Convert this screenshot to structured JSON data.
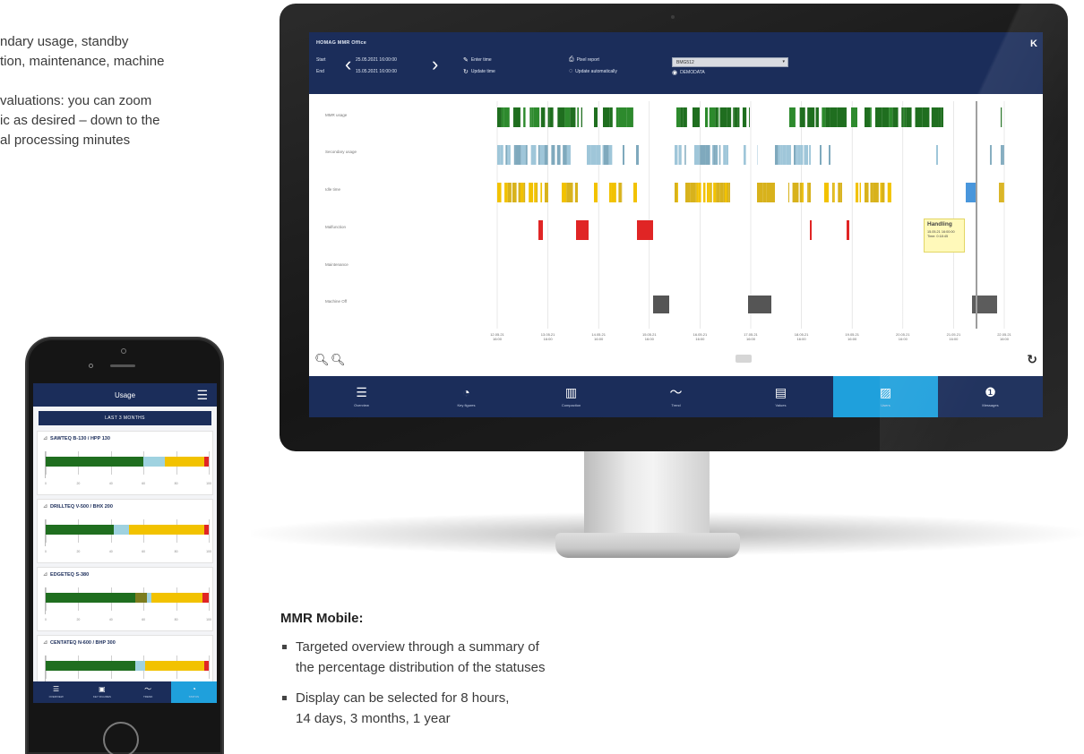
{
  "intro": {
    "para1": "ndary usage, standby\ntion, maintenance, machine",
    "para2": "valuations: you can zoom\nic as desired – down to the\nal processing minutes"
  },
  "app": {
    "title": "HOMAG MMR Office",
    "logo": "K",
    "start_label": "Start",
    "end_label": "End",
    "start_date": "25.05.2021 16:00:00",
    "end_date": "15.05.2021 16:00:00",
    "enter_time": "Enter time",
    "update_time": "Update time",
    "pixel_report": "Pixel report",
    "update_auto": "Update automatically",
    "machine": "BMG512",
    "demodata": "DEMODATA",
    "rows": [
      "MMR usage",
      "Secondary usage",
      "Idle time",
      "Malfunction",
      "Maintenance",
      "Machine Off"
    ],
    "time_ticks": [
      "12.05.21\n16:00",
      "13.05.21\n16:00",
      "14.05.21\n16:00",
      "15.05.21\n16:00",
      "16.05.21\n16:00",
      "17.05.21\n16:00",
      "18.05.21\n16:00",
      "19.05.21\n16:00",
      "20.05.21\n16:00",
      "21.05.21\n16:00",
      "22.05.21\n16:00"
    ],
    "tooltip": {
      "title": "Handling",
      "lines": "15.05.21 16:00:00\nTime: 0:18:45"
    },
    "nav": [
      {
        "label": "Overview",
        "icon": "☰"
      },
      {
        "label": "Key figures",
        "icon": "◔"
      },
      {
        "label": "Compaction",
        "icon": "▥"
      },
      {
        "label": "Trend",
        "icon": "〜"
      },
      {
        "label": "Values",
        "icon": "▤"
      },
      {
        "label": "Users",
        "icon": "▨",
        "active": true
      },
      {
        "label": "Messages",
        "icon": "❶"
      }
    ],
    "colors": {
      "dark_green": "#1f6e1f",
      "light_blue": "#9fc6d9",
      "yellow": "#f2c200",
      "red": "#e02525",
      "gray": "#555555",
      "navy": "#1b2d5a",
      "accent": "#1fa0dc"
    }
  },
  "phone": {
    "title": "Usage",
    "period": "LAST 3 MONTHS",
    "ticks": [
      "0",
      "20",
      "40",
      "60",
      "80",
      "100"
    ],
    "machines": [
      {
        "name": "SAWTEQ B-130 / HPP 130",
        "segments": [
          {
            "color": "#1f6e1f",
            "pct": 60
          },
          {
            "color": "#9fd2e0",
            "pct": 13
          },
          {
            "color": "#f2c200",
            "pct": 24
          },
          {
            "color": "#e02525",
            "pct": 3
          }
        ]
      },
      {
        "name": "DRILLTEQ V-500 / BHX 200",
        "segments": [
          {
            "color": "#1f6e1f",
            "pct": 42
          },
          {
            "color": "#9fd2e0",
            "pct": 9
          },
          {
            "color": "#f2c200",
            "pct": 46
          },
          {
            "color": "#e02525",
            "pct": 3
          }
        ]
      },
      {
        "name": "EDGETEQ S-380",
        "segments": [
          {
            "color": "#1f6e1f",
            "pct": 55
          },
          {
            "color": "#7d7d1f",
            "pct": 7
          },
          {
            "color": "#9fd2e0",
            "pct": 3
          },
          {
            "color": "#f2c200",
            "pct": 31
          },
          {
            "color": "#e02525",
            "pct": 4
          }
        ]
      },
      {
        "name": "CENTATEQ N-600 / BHP 300",
        "segments": [
          {
            "color": "#1f6e1f",
            "pct": 55
          },
          {
            "color": "#9fd2e0",
            "pct": 6
          },
          {
            "color": "#f2c200",
            "pct": 36
          },
          {
            "color": "#e02525",
            "pct": 3
          }
        ]
      }
    ],
    "nav": [
      {
        "label": "OVERVIEW",
        "icon": "☰"
      },
      {
        "label": "KEY FIGURES",
        "icon": "▣"
      },
      {
        "label": "TREND",
        "icon": "〜"
      },
      {
        "label": "STATUS",
        "icon": "◔",
        "active": true
      }
    ]
  },
  "mobile": {
    "heading": "MMR Mobile:",
    "bullets": [
      "Targeted overview through a summary of\nthe percentage distribution of the statuses",
      "Display can be selected for 8 hours,\n14 days, 3 months, 1 year"
    ]
  }
}
